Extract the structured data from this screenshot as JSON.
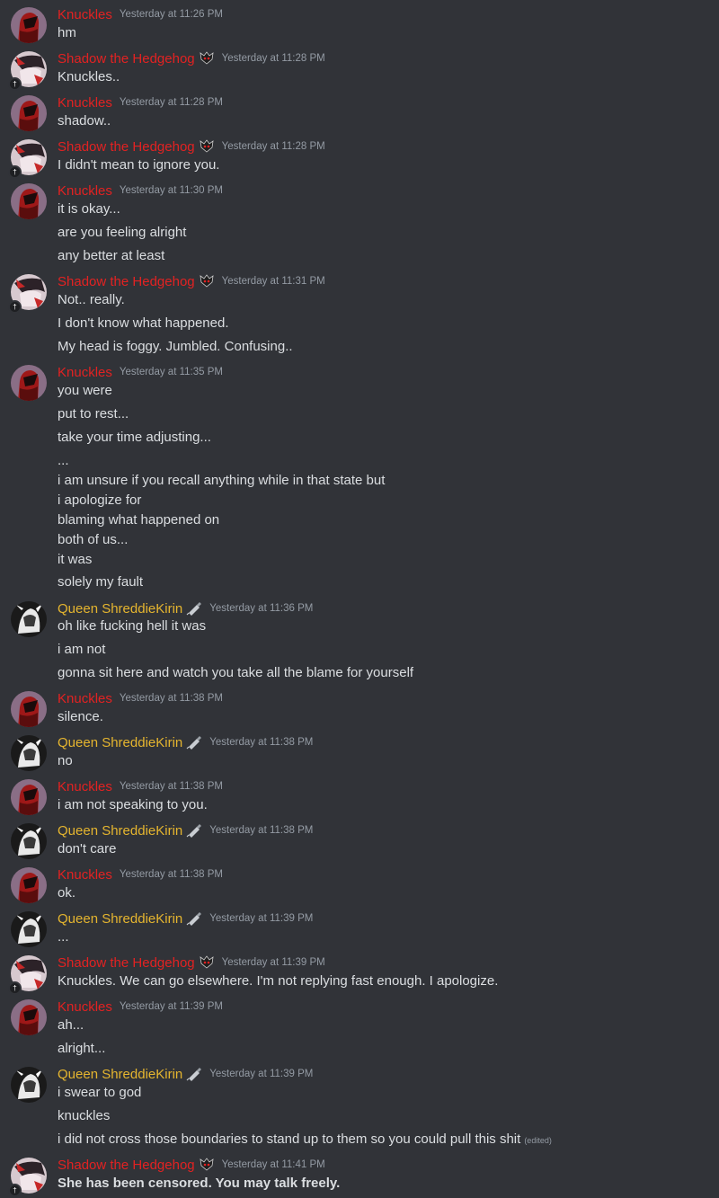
{
  "messages": [
    {
      "author": "Knuckles",
      "who": "knuckles",
      "time": "Yesterday at 11:26 PM",
      "lines": [
        "hm"
      ]
    },
    {
      "author": "Shadow the Hedgehog",
      "who": "shadow",
      "time": "Yesterday at 11:28 PM",
      "lines": [
        "Knuckles.."
      ]
    },
    {
      "author": "Knuckles",
      "who": "knuckles",
      "time": "Yesterday at 11:28 PM",
      "lines": [
        "shadow.."
      ]
    },
    {
      "author": "Shadow the Hedgehog",
      "who": "shadow",
      "time": "Yesterday at 11:28 PM",
      "lines": [
        "I didn't mean to ignore you."
      ]
    },
    {
      "author": "Knuckles",
      "who": "knuckles",
      "time": "Yesterday at 11:30 PM",
      "lines": [
        "it is okay...",
        "are you feeling alright",
        "any better at least"
      ]
    },
    {
      "author": "Shadow the Hedgehog",
      "who": "shadow",
      "time": "Yesterday at 11:31 PM",
      "lines": [
        "Not.. really.",
        "I don't know what happened.",
        "My head is foggy. Jumbled. Confusing.."
      ]
    },
    {
      "author": "Knuckles",
      "who": "knuckles",
      "time": "Yesterday at 11:35 PM",
      "lines": [
        "you were",
        "put to rest...",
        "take your time adjusting...",
        "...",
        "i am unsure if you recall anything while in that state but",
        "i apologize for",
        "blaming what happened on",
        "both of us...",
        "it was",
        "solely my fault"
      ]
    },
    {
      "author": "Queen ShreddieKirin",
      "who": "queen",
      "time": "Yesterday at 11:36 PM",
      "lines": [
        "oh like fucking hell it was",
        "i am not",
        "gonna sit here and watch you take all the blame for yourself"
      ]
    },
    {
      "author": "Knuckles",
      "who": "knuckles",
      "time": "Yesterday at 11:38 PM",
      "lines": [
        "silence."
      ]
    },
    {
      "author": "Queen ShreddieKirin",
      "who": "queen",
      "time": "Yesterday at 11:38 PM",
      "lines": [
        "no"
      ]
    },
    {
      "author": "Knuckles",
      "who": "knuckles",
      "time": "Yesterday at 11:38 PM",
      "lines": [
        "i am not speaking to you."
      ]
    },
    {
      "author": "Queen ShreddieKirin",
      "who": "queen",
      "time": "Yesterday at 11:38 PM",
      "lines": [
        "don't care"
      ]
    },
    {
      "author": "Knuckles",
      "who": "knuckles",
      "time": "Yesterday at 11:38 PM",
      "lines": [
        "ok."
      ]
    },
    {
      "author": "Queen ShreddieKirin",
      "who": "queen",
      "time": "Yesterday at 11:39 PM",
      "lines": [
        "..."
      ]
    },
    {
      "author": "Shadow the Hedgehog",
      "who": "shadow",
      "time": "Yesterday at 11:39 PM",
      "lines": [
        "Knuckles. We can go elsewhere. I'm not replying fast enough. I apologize."
      ]
    },
    {
      "author": "Knuckles",
      "who": "knuckles",
      "time": "Yesterday at 11:39 PM",
      "lines": [
        "ah...",
        "alright..."
      ]
    },
    {
      "author": "Queen ShreddieKirin",
      "who": "queen",
      "time": "Yesterday at 11:39 PM",
      "lines": [
        "i swear to god",
        "knuckles",
        "i did not cross those boundaries to stand up to them so you could pull this shit"
      ],
      "edited": "(edited)"
    },
    {
      "author": "Shadow the Hedgehog",
      "who": "shadow",
      "time": "Yesterday at 11:41 PM",
      "lines": [
        "She has been censored. You may talk freely."
      ],
      "bold": true
    }
  ],
  "icons": {
    "knuckles": "avatar-knuckles",
    "shadow": "avatar-shadow",
    "queen": "avatar-queen",
    "shadow_role": "shadow-emblem-icon",
    "queen_role": "syringe-icon"
  },
  "colors": {
    "background": "#313338",
    "knuckles_name": "#e22222",
    "shadow_name": "#e22222",
    "queen_name": "#e5b52f",
    "timestamp": "#949ba4",
    "text": "#dbdee1"
  }
}
